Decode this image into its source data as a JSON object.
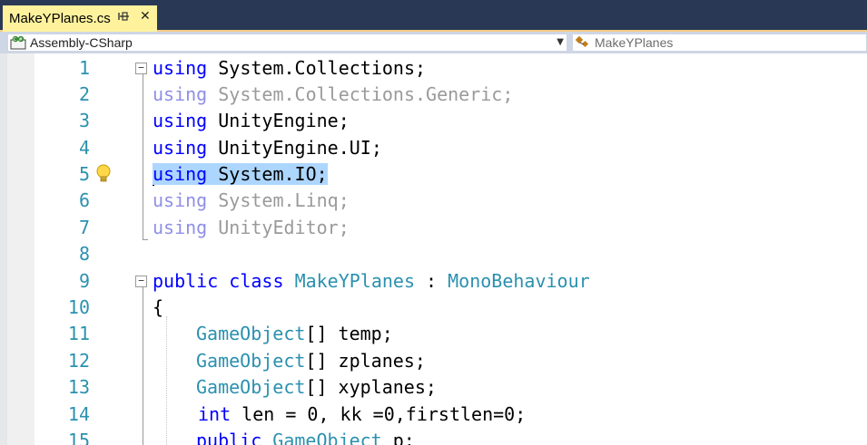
{
  "tab": {
    "label": "MakeYPlanes.cs",
    "pin_glyph": "⊕",
    "close_glyph": "✕"
  },
  "navbar": {
    "project_dropdown": {
      "value": "Assembly-CSharp",
      "icon": "csharp-project-icon"
    },
    "type_dropdown": {
      "value": "MakeYPlanes",
      "icon": "class-icon"
    }
  },
  "editor": {
    "line_numbers": [
      "1",
      "2",
      "3",
      "4",
      "5",
      "6",
      "7",
      "8",
      "9",
      "10",
      "11",
      "12",
      "13",
      "14",
      "15"
    ],
    "collapse_glyph": "−",
    "lines": [
      {
        "kw": "using",
        "rest": " System.Collections;"
      },
      {
        "kw": "using",
        "rest": " System.Collections.Generic;"
      },
      {
        "kw": "using",
        "rest": " UnityEngine;"
      },
      {
        "kw": "using",
        "rest": " UnityEngine.UI;"
      },
      {
        "kw": "using",
        "rest": " System.IO;"
      },
      {
        "kw": "using",
        "rest": " System.Linq;"
      },
      {
        "kw": "using",
        "rest": " UnityEditor;"
      },
      {
        "text": ""
      },
      {
        "kw1": "public",
        "kw2": "class",
        "name": "MakeYPlanes",
        "colon": " : ",
        "base": "MonoBehaviour"
      },
      {
        "text": "{"
      },
      {
        "type": "GameObject",
        "rest": "[] temp;"
      },
      {
        "type": "GameObject",
        "rest": "[] zplanes;"
      },
      {
        "type": "GameObject",
        "rest": "[] xyplanes;"
      },
      {
        "kw": "int",
        "rest": " len = 0, kk =0,firstlen=0;"
      },
      {
        "kw": "public",
        "type": "GameObject",
        "rest": " p;"
      }
    ]
  },
  "colors": {
    "keyword": "#0000ff",
    "type": "#2b91af",
    "faded_keyword": "#8f8fe6",
    "faded_text": "#9a9a9a",
    "selection": "#add6ff",
    "tab_active": "#fff29d",
    "tabstrip_bg": "#293955"
  }
}
